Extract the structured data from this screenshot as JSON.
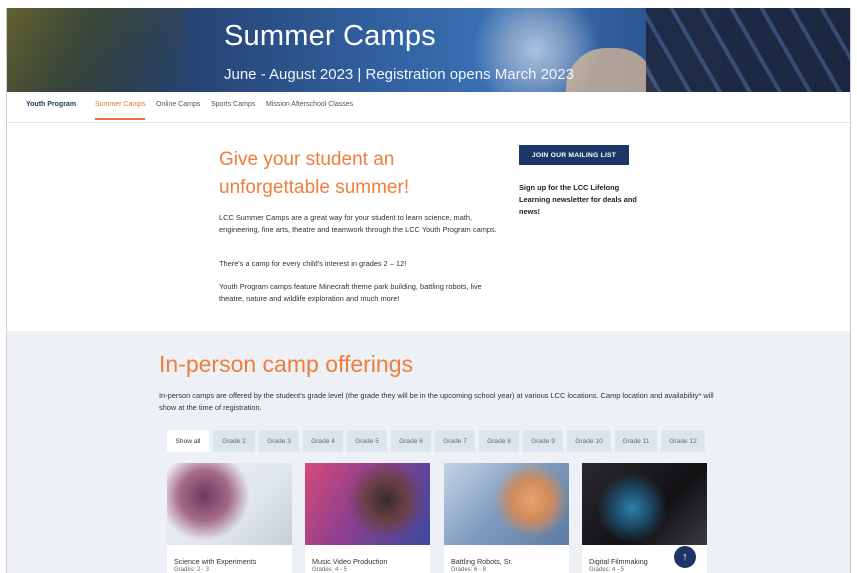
{
  "hero": {
    "title": "Summer Camps",
    "subtitle": "June - August 2023 | Registration opens March 2023"
  },
  "nav": {
    "items": [
      {
        "label": "Youth Program"
      },
      {
        "label": "Summer Camps"
      },
      {
        "label": "Online Camps"
      },
      {
        "label": "Sports Camps"
      },
      {
        "label": "Mission Afterschool Classes"
      }
    ]
  },
  "intro": {
    "heading": "Give your student an unforgettable summer!",
    "paragraphs": [
      "LCC Summer Camps are a great way for your student to learn science, math, engineering, fine arts, theatre and teamwork through the LCC Youth Program camps.",
      "There's a camp for every child's interest in grades 2 – 12!",
      "Youth Program camps feature Minecraft theme park building, battling robots, live theatre, nature and wildlife exploration and much more!"
    ],
    "mailing_button": "JOIN OUR MAILING LIST",
    "signup_text": "Sign up for the LCC Lifelong Learning newsletter for deals and news!"
  },
  "offerings": {
    "heading": "In-person camp offerings",
    "description": "In-person camps are offered by the student's grade level (the grade they will be in the upcoming school year) at various LCC locations. Camp location and availability* will show at the time of registration.",
    "tabs": [
      "Show all",
      "Grade 2",
      "Grade 3",
      "Grade 4",
      "Grade 5",
      "Grade 6",
      "Grade 7",
      "Grade 8",
      "Grade 9",
      "Grade 10",
      "Grade 11",
      "Grade 12"
    ],
    "cards": [
      {
        "name": "Science with Experiments",
        "grades": "Grades: 2 - 3"
      },
      {
        "name": "Music Video Production",
        "grades": "Grades: 4 - 5"
      },
      {
        "name": "Battling Robots, Sr.",
        "grades": "Grades: 6 - 8"
      },
      {
        "name": "Digital Filmmaking",
        "grades": "Grades: 4 - 5"
      }
    ]
  },
  "scroll_top": {
    "icon": "arrow-up-icon",
    "glyph": "↑"
  }
}
